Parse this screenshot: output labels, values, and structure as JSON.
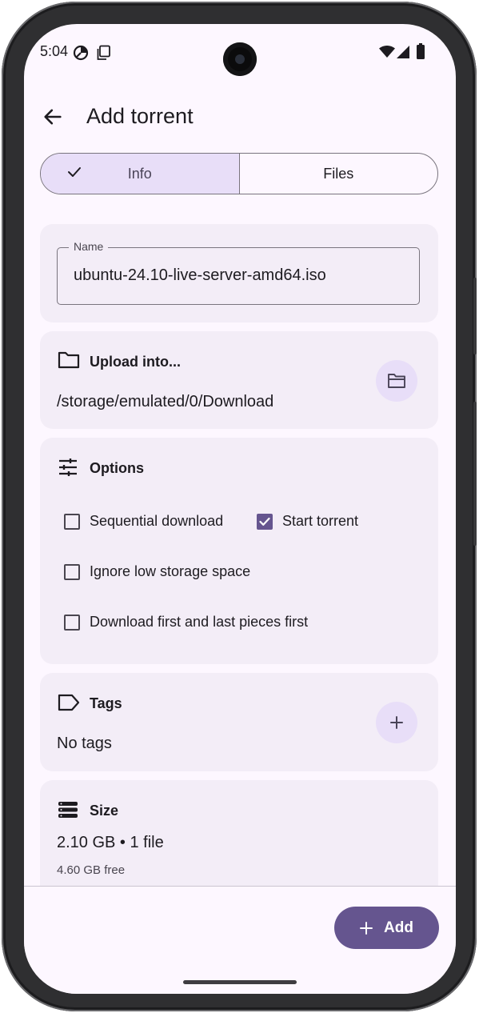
{
  "status_bar": {
    "time": "5:04",
    "icons": [
      "data-saver-icon",
      "screenshot-icon",
      "wifi-icon",
      "signal-icon",
      "battery-icon"
    ]
  },
  "app_bar": {
    "title": "Add torrent",
    "back_icon": "arrow-back-icon"
  },
  "tabs": [
    {
      "label": "Info",
      "selected": true
    },
    {
      "label": "Files",
      "selected": false
    }
  ],
  "name_field": {
    "label": "Name",
    "value": "ubuntu-24.10-live-server-amd64.iso"
  },
  "upload": {
    "title": "Upload into...",
    "path": "/storage/emulated/0/Download",
    "icon": "folder-icon",
    "button_icon": "folder-open-icon"
  },
  "options": {
    "title": "Options",
    "icon": "tune-icon",
    "items": [
      {
        "label": "Sequential download",
        "checked": false
      },
      {
        "label": "Start torrent",
        "checked": true
      },
      {
        "label": "Ignore low storage space",
        "checked": false
      },
      {
        "label": "Download first and last pieces first",
        "checked": false
      }
    ]
  },
  "tags": {
    "title": "Tags",
    "value": "No tags",
    "icon": "label-icon",
    "button_icon": "add-icon"
  },
  "size": {
    "title": "Size",
    "value": "2.10 GB • 1 file",
    "free": "4.60 GB free",
    "icon": "storage-icon"
  },
  "fab": {
    "label": "Add",
    "icon": "add-icon"
  },
  "colors": {
    "primary": "#65558f",
    "secondary_container": "#e8def8",
    "surface": "#fdf7ff",
    "card": "#f3edf7"
  }
}
